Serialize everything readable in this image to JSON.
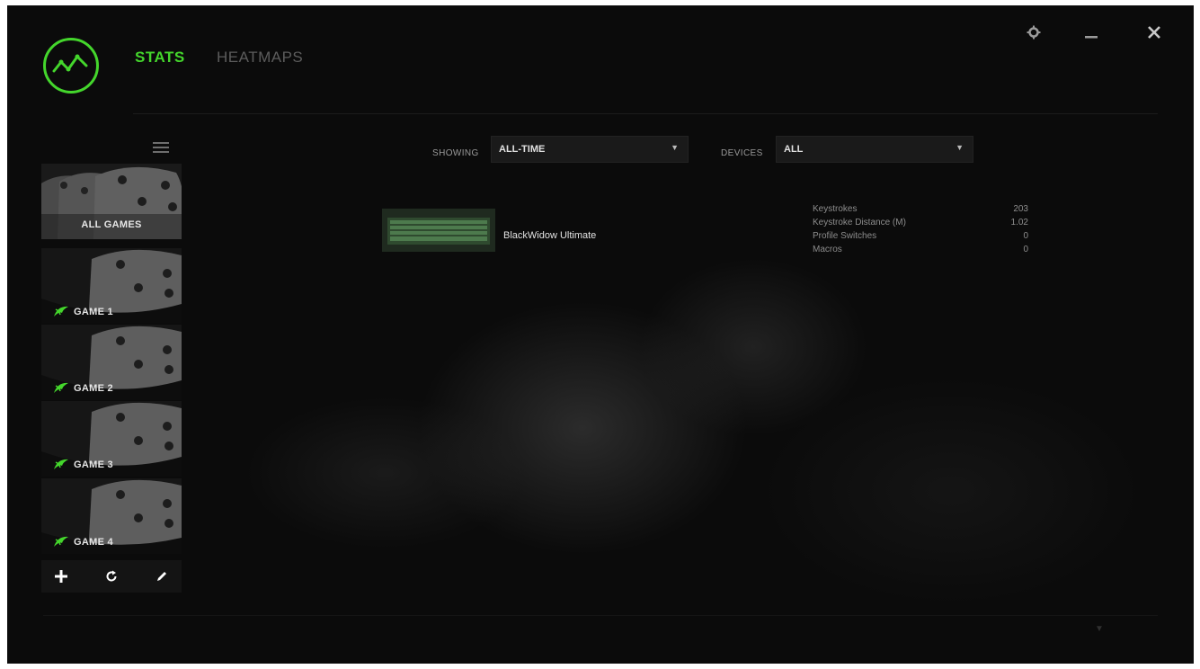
{
  "nav": {
    "tabs": [
      {
        "label": "STATS",
        "active": true
      },
      {
        "label": "HEATMAPS",
        "active": false
      }
    ]
  },
  "window_controls": {
    "settings": "gear-icon",
    "minimize": "minimize-icon",
    "close": "close-icon"
  },
  "sidebar": {
    "games": [
      {
        "label": "ALL GAMES",
        "selected": true
      },
      {
        "label": "GAME 1",
        "selected": false
      },
      {
        "label": "GAME 2",
        "selected": false
      },
      {
        "label": "GAME 3",
        "selected": false
      },
      {
        "label": "GAME 4",
        "selected": false
      }
    ],
    "tools": [
      "plus-icon",
      "refresh-icon",
      "edit-icon"
    ]
  },
  "filters": {
    "showing_label": "SHOWING",
    "showing_value": "ALL-TIME",
    "devices_label": "DEVICES",
    "devices_value": "ALL"
  },
  "device": {
    "name": "BlackWidow Ultimate",
    "stats": [
      {
        "label": "Keystrokes",
        "value": "203"
      },
      {
        "label": "Keystroke Distance (M)",
        "value": "1.02"
      },
      {
        "label": "Profile Switches",
        "value": "0"
      },
      {
        "label": "Macros",
        "value": "0"
      }
    ]
  },
  "colors": {
    "accent": "#44d62c",
    "background": "#0b0b0b"
  }
}
